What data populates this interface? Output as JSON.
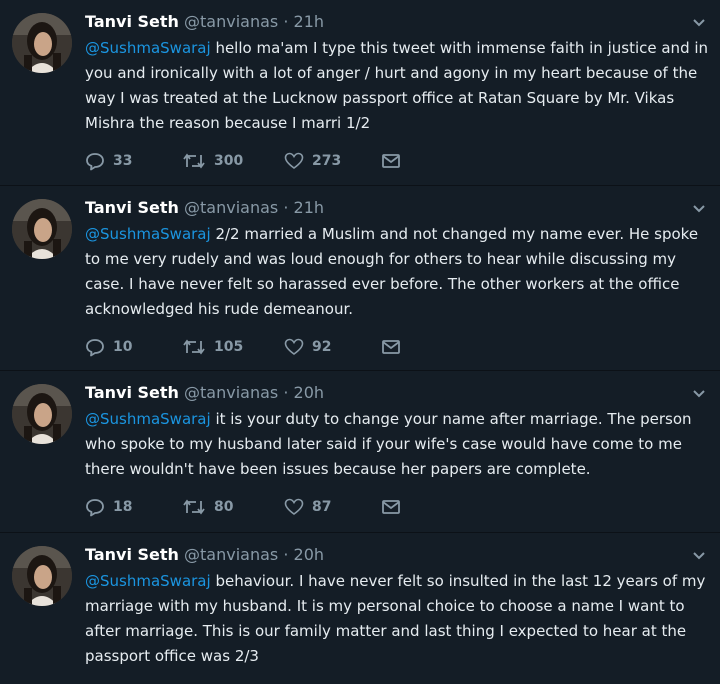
{
  "tweets": [
    {
      "name": "Tanvi Seth",
      "handle": "@tanvianas",
      "dot": "·",
      "time": "21h",
      "mention": "@SushmaSwaraj",
      "text": " hello ma'am I type this tweet with immense faith in justice and in you and ironically with a lot of anger / hurt and agony in my heart because of the way I was treated at the Lucknow passport office at Ratan Square by Mr. Vikas Mishra the reason because I marri 1/2",
      "replies": "33",
      "retweets": "300",
      "likes": "273"
    },
    {
      "name": "Tanvi Seth",
      "handle": "@tanvianas",
      "dot": "·",
      "time": "21h",
      "mention": "@SushmaSwaraj",
      "text": " 2/2 married a Muslim and not changed my name ever. He spoke to me very rudely and was loud enough for others to hear while discussing my case. I have never felt so harassed ever before. The other workers at the office acknowledged his rude demeanour.",
      "replies": "10",
      "retweets": "105",
      "likes": "92"
    },
    {
      "name": "Tanvi Seth",
      "handle": "@tanvianas",
      "dot": "·",
      "time": "20h",
      "mention": "@SushmaSwaraj",
      "text": " it is your duty to change your name after marriage. The person who spoke to my husband later said if your wife's case would have come to me there wouldn't have been issues because her papers are complete.",
      "replies": "18",
      "retweets": "80",
      "likes": "87"
    },
    {
      "name": "Tanvi Seth",
      "handle": "@tanvianas",
      "dot": "·",
      "time": "20h",
      "mention": "@SushmaSwaraj",
      "text": " behaviour. I have never felt so insulted in the last 12 years of my marriage with my husband. It is my personal choice to choose a name I want to after marriage. This is our family matter and last thing I expected to hear at the passport office was 2/3"
    }
  ],
  "colors": {
    "background": "#141d26",
    "mention": "#1b95e0",
    "muted": "#8899a6",
    "text": "#e6ecf0"
  },
  "icons": {
    "reply": "reply-icon",
    "retweet": "retweet-icon",
    "like": "heart-icon",
    "dm": "envelope-icon",
    "more": "chevron-down-icon"
  }
}
